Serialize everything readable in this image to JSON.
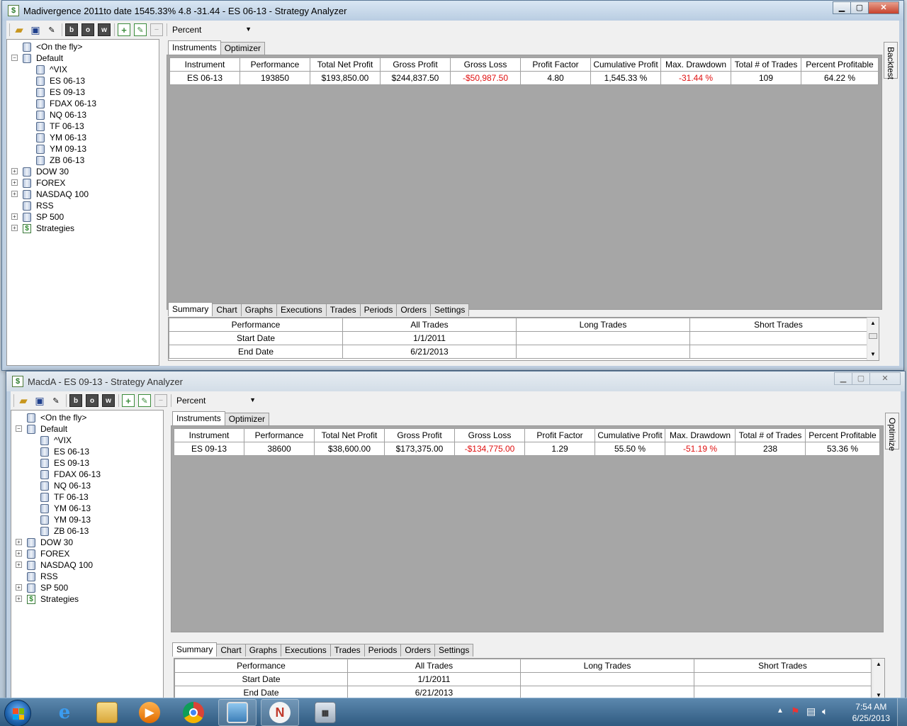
{
  "windows": [
    {
      "title": "Madivergence 2011to date 1545.33%  4.8  -31.44 - ES 06-13 - Strategy Analyzer",
      "toolbar": {
        "mode_value": "Percent"
      },
      "tree": {
        "on_the_fly": "<On the fly>",
        "default": "Default",
        "instruments": [
          "^VIX",
          "ES 06-13",
          "ES 09-13",
          "FDAX 06-13",
          "NQ 06-13",
          "TF 06-13",
          "YM 06-13",
          "YM 09-13",
          "ZB 06-13"
        ],
        "groups": [
          "DOW 30",
          "FOREX",
          "NASDAQ 100",
          "RSS",
          "SP 500",
          "Strategies"
        ]
      },
      "top_tabs": [
        "Instruments",
        "Optimizer"
      ],
      "side_tab": "Backtest",
      "grid": {
        "columns": [
          "Instrument",
          "Performance",
          "Total Net Profit",
          "Gross Profit",
          "Gross Loss",
          "Profit Factor",
          "Cumulative Profit",
          "Max. Drawdown",
          "Total # of Trades",
          "Percent Profitable"
        ],
        "row": [
          "ES 06-13",
          "193850",
          "$193,850.00",
          "$244,837.50",
          "-$50,987.50",
          "4.80",
          "1,545.33 %",
          "-31.44 %",
          "109",
          "64.22 %"
        ]
      },
      "bottom_tabs": [
        "Summary",
        "Chart",
        "Graphs",
        "Executions",
        "Trades",
        "Periods",
        "Orders",
        "Settings"
      ],
      "summary": {
        "columns": [
          "Performance",
          "All Trades",
          "Long Trades",
          "Short Trades"
        ],
        "rows": [
          [
            "Start Date",
            "1/1/2011",
            "",
            ""
          ],
          [
            "End Date",
            "6/21/2013",
            "",
            ""
          ]
        ]
      }
    },
    {
      "title": "MacdA - ES 09-13 - Strategy Analyzer",
      "toolbar": {
        "mode_value": "Percent"
      },
      "tree": {
        "on_the_fly": "<On the fly>",
        "default": "Default",
        "instruments": [
          "^VIX",
          "ES 06-13",
          "ES 09-13",
          "FDAX 06-13",
          "NQ 06-13",
          "TF 06-13",
          "YM 06-13",
          "YM 09-13",
          "ZB 06-13"
        ],
        "groups": [
          "DOW 30",
          "FOREX",
          "NASDAQ 100",
          "RSS",
          "SP 500",
          "Strategies"
        ]
      },
      "top_tabs": [
        "Instruments",
        "Optimizer"
      ],
      "side_tab": "Optimize",
      "grid": {
        "columns": [
          "Instrument",
          "Performance",
          "Total Net Profit",
          "Gross Profit",
          "Gross Loss",
          "Profit Factor",
          "Cumulative Profit",
          "Max. Drawdown",
          "Total # of Trades",
          "Percent Profitable"
        ],
        "row": [
          "ES 09-13",
          "38600",
          "$38,600.00",
          "$173,375.00",
          "-$134,775.00",
          "1.29",
          "55.50 %",
          "-51.19 %",
          "238",
          "53.36 %"
        ]
      },
      "bottom_tabs": [
        "Summary",
        "Chart",
        "Graphs",
        "Executions",
        "Trades",
        "Periods",
        "Orders",
        "Settings"
      ],
      "summary": {
        "columns": [
          "Performance",
          "All Trades",
          "Long Trades",
          "Short Trades"
        ],
        "rows": [
          [
            "Start Date",
            "1/1/2011",
            "",
            ""
          ],
          [
            "End Date",
            "6/21/2013",
            "",
            ""
          ]
        ]
      }
    }
  ],
  "taskbar": {
    "time": "7:54 AM",
    "date": "6/25/2013",
    "apps": [
      "internet-explorer",
      "file-explorer",
      "media-player",
      "chrome",
      "photo-viewer",
      "ninjatrader",
      "calculator"
    ]
  },
  "colors": {
    "negative": "#e01010",
    "grid_background": "#a6a6a6"
  }
}
